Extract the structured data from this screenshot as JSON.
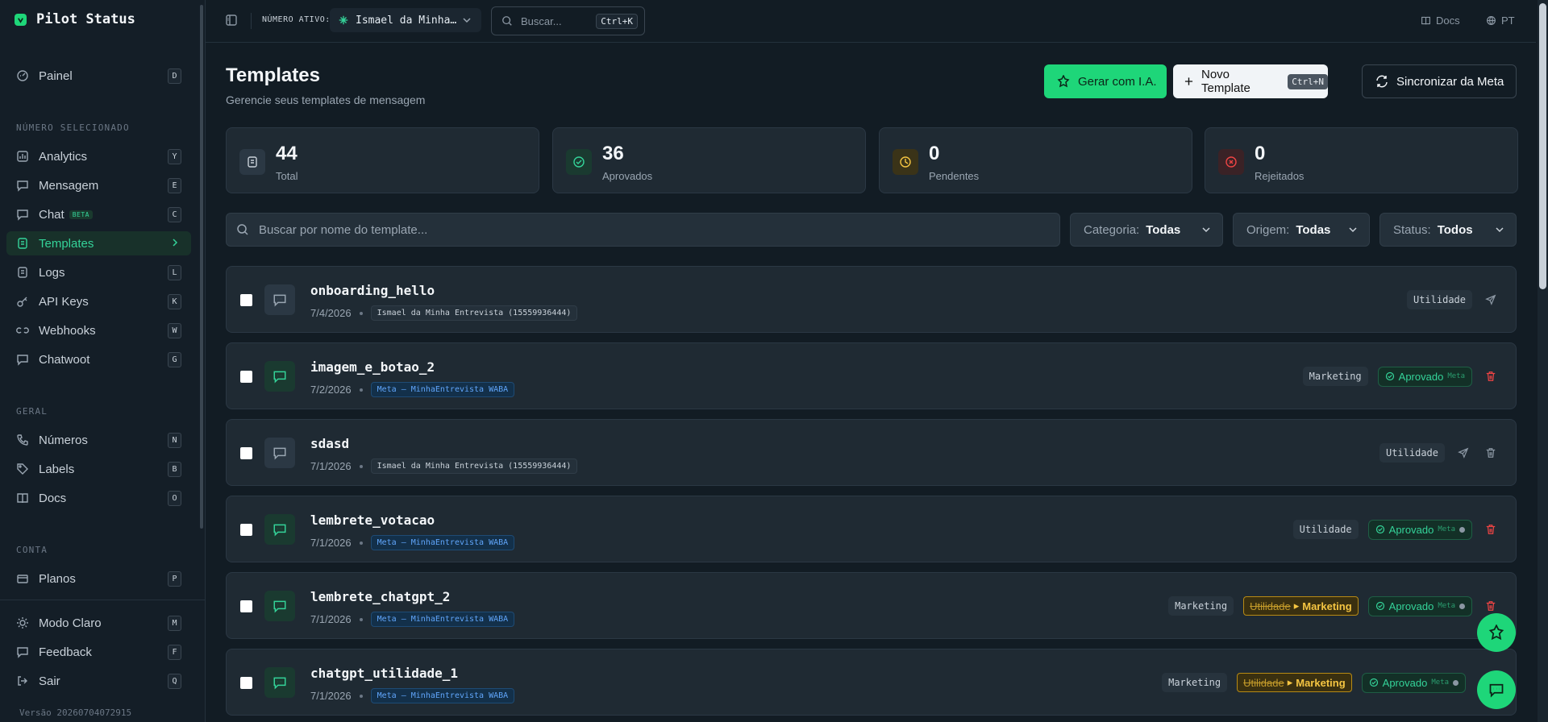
{
  "app": {
    "name": "Pilot Status",
    "version": "Versão 20260704072915"
  },
  "sidebar": {
    "panel": {
      "label": "Painel",
      "key": "D"
    },
    "sections": {
      "selected": "NÚMERO SELECIONADO",
      "general": "GERAL",
      "account": "CONTA"
    },
    "items": [
      {
        "label": "Analytics",
        "key": "Y",
        "icon": "chart-icon"
      },
      {
        "label": "Mensagem",
        "key": "E",
        "icon": "message-icon"
      },
      {
        "label": "Chat",
        "key": "C",
        "icon": "chat-icon",
        "badge": "BETA"
      },
      {
        "label": "Templates",
        "key": "",
        "icon": "template-icon",
        "active": true
      },
      {
        "label": "Logs",
        "key": "L",
        "icon": "logs-icon"
      },
      {
        "label": "API Keys",
        "key": "K",
        "icon": "key-icon"
      },
      {
        "label": "Webhooks",
        "key": "W",
        "icon": "webhook-icon"
      },
      {
        "label": "Chatwoot",
        "key": "G",
        "icon": "chatwoot-icon"
      }
    ],
    "general": [
      {
        "label": "Números",
        "key": "N"
      },
      {
        "label": "Labels",
        "key": "B"
      },
      {
        "label": "Docs",
        "key": "O"
      }
    ],
    "account": [
      {
        "label": "Planos",
        "key": "P"
      }
    ],
    "bottom": [
      {
        "label": "Modo Claro",
        "key": "M"
      },
      {
        "label": "Feedback",
        "key": "F"
      },
      {
        "label": "Sair",
        "key": "Q"
      }
    ]
  },
  "topbar": {
    "active_label": "NÚMERO ATIVO:",
    "active_number": "Ismael da Minha…",
    "search_placeholder": "Buscar...",
    "search_shortcut": "Ctrl+K",
    "docs": "Docs",
    "lang": "PT"
  },
  "page": {
    "title": "Templates",
    "subtitle": "Gerencie seus templates de mensagem",
    "btn_ai": "Gerar com I.A.",
    "btn_new": "Novo Template",
    "btn_new_shortcut": "Ctrl+N",
    "btn_sync": "Sincronizar da Meta"
  },
  "stats": [
    {
      "value": "44",
      "label": "Total"
    },
    {
      "value": "36",
      "label": "Aprovados"
    },
    {
      "value": "0",
      "label": "Pendentes"
    },
    {
      "value": "0",
      "label": "Rejeitados"
    }
  ],
  "filters": {
    "search_placeholder": "Buscar por nome do template...",
    "category_label": "Categoria:",
    "category_value": "Todas",
    "origin_label": "Origem:",
    "origin_value": "Todas",
    "status_label": "Status:",
    "status_value": "Todos"
  },
  "templates": [
    {
      "name": "onboarding_hello",
      "date": "7/4/2026",
      "source": "Ismael da Minha Entrevista (15559936444)",
      "source_type": "number",
      "category": "Utilidade",
      "status": "",
      "change_from": "",
      "change_to": ""
    },
    {
      "name": "imagem_e_botao_2",
      "date": "7/2/2026",
      "source": "Meta — MinhaEntrevista WABA",
      "source_type": "meta",
      "category": "Marketing",
      "status": "Aprovado",
      "status_tag": "Meta",
      "change_from": "",
      "change_to": ""
    },
    {
      "name": "sdasd",
      "date": "7/1/2026",
      "source": "Ismael da Minha Entrevista (15559936444)",
      "source_type": "number",
      "category": "Utilidade",
      "status": "",
      "change_from": "",
      "change_to": ""
    },
    {
      "name": "lembrete_votacao",
      "date": "7/1/2026",
      "source": "Meta — MinhaEntrevista WABA",
      "source_type": "meta",
      "category": "Utilidade",
      "status": "Aprovado",
      "status_tag": "Meta",
      "change_from": "",
      "change_to": ""
    },
    {
      "name": "lembrete_chatgpt_2",
      "date": "7/1/2026",
      "source": "Meta — MinhaEntrevista WABA",
      "source_type": "meta",
      "category": "Marketing",
      "status": "Aprovado",
      "status_tag": "Meta",
      "change_from": "Utilidade",
      "change_to": "Marketing"
    },
    {
      "name": "chatgpt_utilidade_1",
      "date": "7/1/2026",
      "source": "Meta — MinhaEntrevista WABA",
      "source_type": "meta",
      "category": "Marketing",
      "status": "Aprovado",
      "status_tag": "Meta",
      "change_from": "Utilidade",
      "change_to": "Marketing"
    }
  ],
  "colors": {
    "accent": "#1ed679",
    "bg": "#121c24",
    "card": "#1f2a33",
    "danger": "#ef4444",
    "warning": "#f5c542"
  }
}
